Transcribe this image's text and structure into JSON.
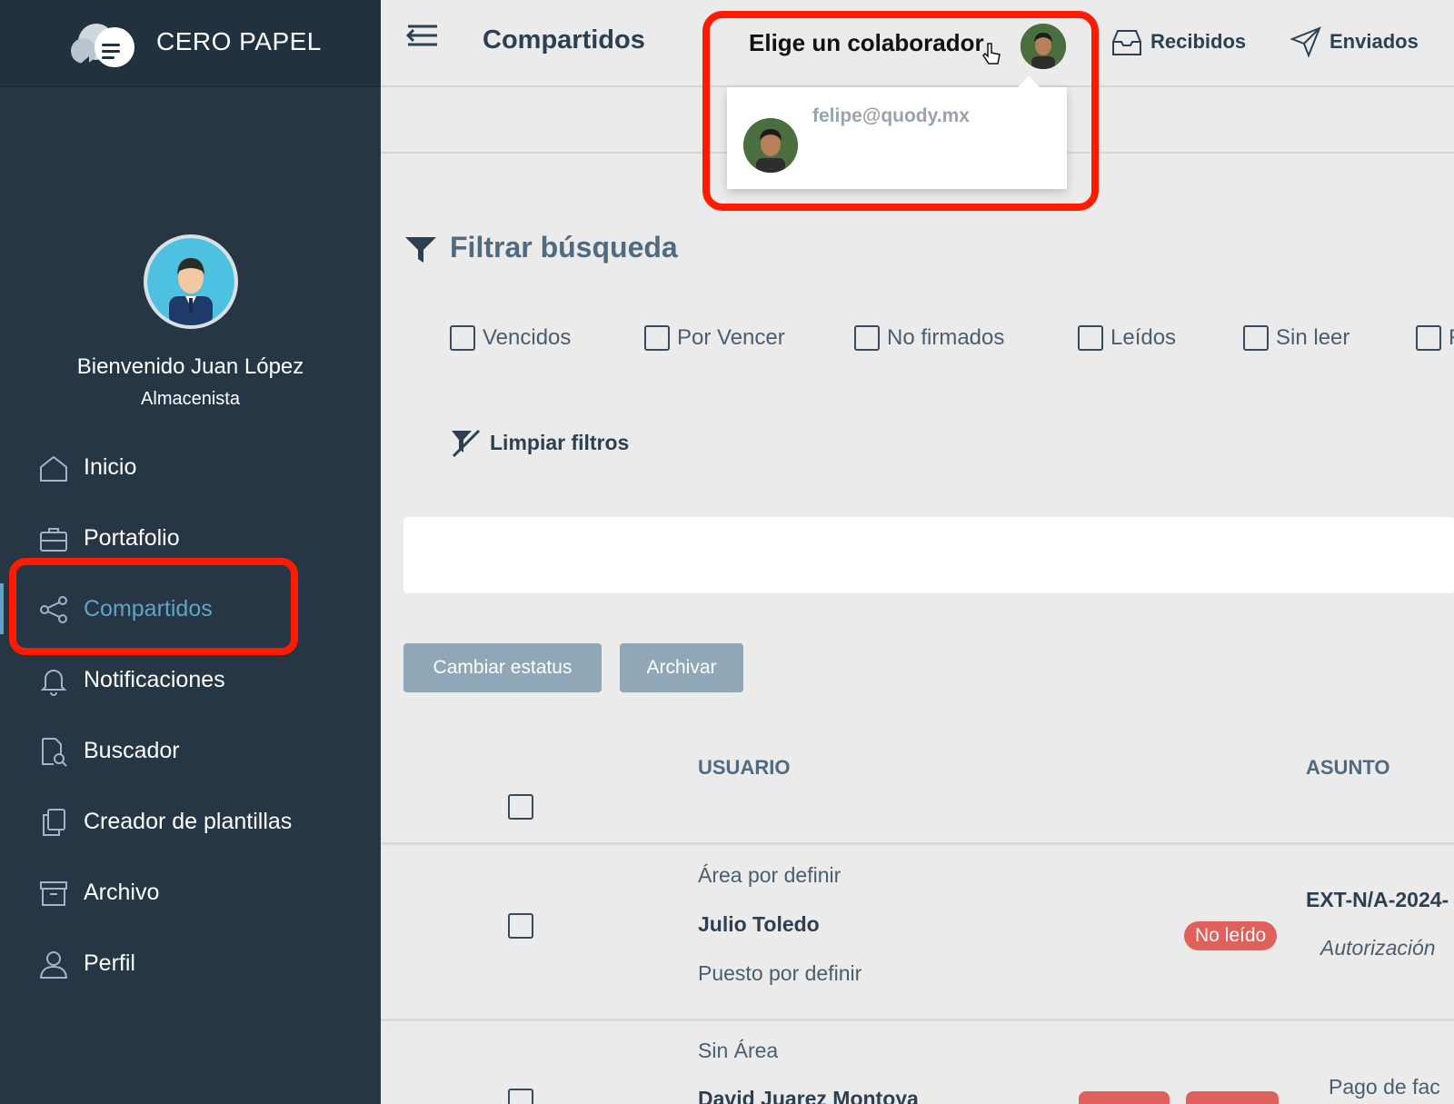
{
  "brand": {
    "name": "CERO PAPEL"
  },
  "user": {
    "welcome": "Bienvenido Juan López",
    "role": "Almacenista"
  },
  "sidebar": {
    "items": [
      {
        "label": "Inicio",
        "icon": "home-icon"
      },
      {
        "label": "Portafolio",
        "icon": "briefcase-icon"
      },
      {
        "label": "Compartidos",
        "icon": "share-icon",
        "active": true
      },
      {
        "label": "Notificaciones",
        "icon": "bell-icon"
      },
      {
        "label": "Buscador",
        "icon": "document-search-icon"
      },
      {
        "label": "Creador de plantillas",
        "icon": "copy-icon"
      },
      {
        "label": "Archivo",
        "icon": "archive-icon"
      },
      {
        "label": "Perfil",
        "icon": "user-icon"
      }
    ]
  },
  "header": {
    "title": "Compartidos",
    "collaborator_label": "Elige un colaborador",
    "tabs": [
      {
        "label": "Recibidos",
        "icon": "inbox-icon"
      },
      {
        "label": "Enviados",
        "icon": "send-icon"
      }
    ]
  },
  "dropdown": {
    "email": "felipe@quody.mx"
  },
  "filters": {
    "title": "Filtrar búsqueda",
    "options": [
      "Vencidos",
      "Por Vencer",
      "No firmados",
      "Leídos",
      "Sin leer",
      "F"
    ],
    "clear_label": "Limpiar filtros"
  },
  "actions": {
    "change_status": "Cambiar estatus",
    "archive": "Archivar"
  },
  "table": {
    "headers": {
      "user": "USUARIO",
      "subject": "ASUNTO"
    },
    "rows": [
      {
        "area": "Área por definir",
        "name": "Julio Toledo",
        "position": "Puesto por definir",
        "badge": "No leído",
        "code": "EXT-N/A-2024-",
        "subject": "Autorización"
      },
      {
        "area": "Sin Área",
        "name": "David Juarez Montoya",
        "subject": "Pago de fac"
      }
    ]
  },
  "colors": {
    "sidebar": "#263645",
    "accent": "#5fa3c8",
    "highlight": "#ff1a00",
    "badge": "#e0605b",
    "button": "#8fa7b6"
  }
}
